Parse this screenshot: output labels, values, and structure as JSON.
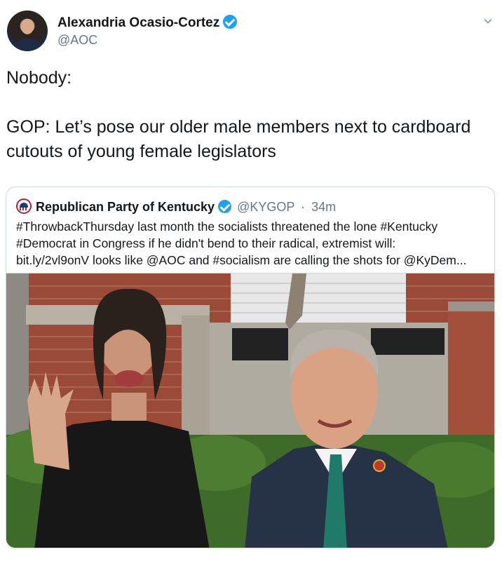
{
  "tweet": {
    "author_name": "Alexandria Ocasio-Cortez",
    "handle": "@AOC",
    "text_lines": [
      "Nobody:",
      "",
      "GOP: Let’s pose our older male members next to cardboard cutouts of young female legislators"
    ]
  },
  "quoted_tweet": {
    "author_name": "Republican Party of Kentucky",
    "handle": "@KYGOP",
    "separator": "·",
    "time": "34m",
    "text_lines": [
      "#ThrowbackThursday last month the socialists threatened the lone #Kentucky",
      "#Democrat in Congress if he didn't bend to their radical, extremist will:",
      "bit.ly/2vl9onV looks like @AOC and #socialism are calling the shots for @KyDem..."
    ]
  },
  "icons": {
    "verified": "verified-badge-icon",
    "menu": "chevron-down-icon",
    "party_logo": "gop-elephant-icon"
  },
  "colors": {
    "text": "#14171a",
    "secondary": "#657786",
    "verified": "#1da1f2",
    "border": "#ccd6dd"
  }
}
